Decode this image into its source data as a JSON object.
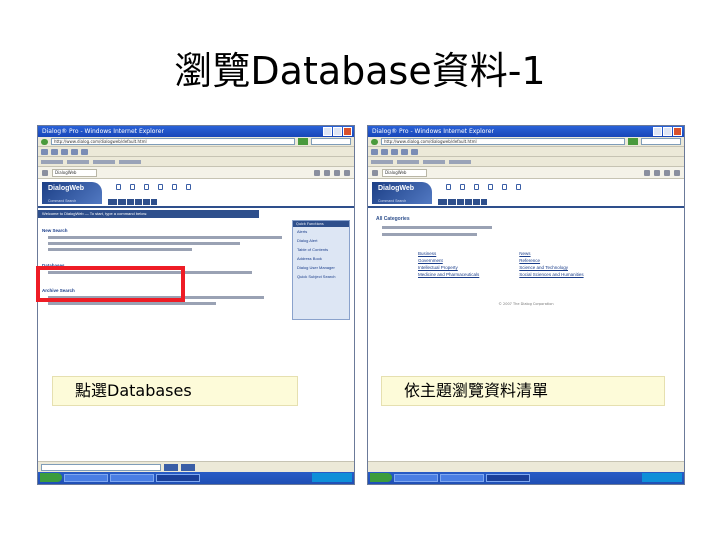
{
  "slide": {
    "title": "瀏覽Database資料-1"
  },
  "left_screenshot": {
    "window_title": "Dialog® Pro - Windows Internet Explorer",
    "address": "http://www.dialog.com/dialogweb/default.html",
    "tab_title": "DialogWeb",
    "logo": "DialogWeb",
    "logo_sub": "Command Search",
    "welcome": "Welcome to DialogWeb — To start, type a command below.",
    "options": [
      "New Search",
      "Databases",
      "Archive Search"
    ],
    "side_panel_title": "Quick Functions",
    "side_panel_items": [
      "Alerts",
      "Dialog Alert",
      "Table of Contents",
      "Address Book",
      "Dialog User Manager",
      "Quick Subject Search"
    ],
    "caption": "點選Databases"
  },
  "right_screenshot": {
    "window_title": "Dialog® Pro - Windows Internet Explorer",
    "address": "http://www.dialog.com/dialogweb/default.html",
    "tab_title": "DialogWeb",
    "logo": "DialogWeb",
    "logo_sub": "Command Search",
    "heading": "All Categories",
    "categories_left": [
      "Business",
      "Government",
      "Intellectual Property",
      "Medicine and Pharmaceuticals"
    ],
    "categories_right": [
      "News",
      "Reference",
      "Science and Technology",
      "Social Sciences and Humanities"
    ],
    "copyright": "© 2007 The Dialog Corporation",
    "caption": "依主題瀏覽資料清單"
  },
  "colors": {
    "highlight": "#ee1c25",
    "caption_bg": "#fdfbd9",
    "dialog_blue": "#2e4f8c"
  }
}
